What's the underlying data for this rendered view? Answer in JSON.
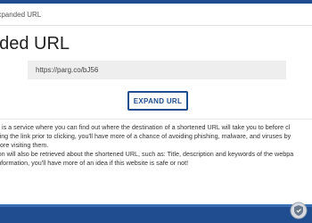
{
  "header": {
    "breadcrumb": "Expanded URL"
  },
  "main": {
    "title": "nded URL",
    "url_value": "https://parg.co/bJ56",
    "expand_button_label": "EXPAND URL"
  },
  "description": {
    "lines": [
      "net is a service where you can find out where the destination of a shortened URL will take you to before cl",
      "nining the link prior to clicking, you'll have more of a chance of avoiding phishing, malware, and viruses by",
      "before visiting them.",
      "ation will also be retrieved about the shortened URL, such as: Title, description and keywords of the webpa",
      "s information, you'll have more of an idea if this website is safe or not!"
    ]
  },
  "colors": {
    "brand": "#1f4d8f",
    "input_bg": "#eeeeee"
  },
  "footer": {
    "badge_icon": "shield-badge-icon"
  }
}
